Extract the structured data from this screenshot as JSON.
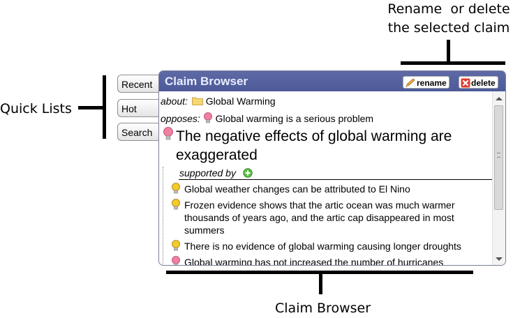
{
  "annotations": {
    "top_line1": "Rename  or delete",
    "top_line2": "the selected claim",
    "left": "Quick Lists",
    "bottom": "Claim Browser"
  },
  "quick_lists": [
    "Recent",
    "Hot",
    "Search"
  ],
  "browser": {
    "title": "Claim Browser",
    "rename_label": "rename",
    "delete_label": "delete",
    "about_label": "about:",
    "about_value": "Global Warming",
    "opposes_label": "opposes:",
    "opposes_value": "Global warming is a serious problem",
    "claim": "The negative effects of global warming are exaggerated",
    "supported_by": "supported by",
    "children": [
      {
        "lines": [
          "Global weather changes can be attributed to El Nino"
        ],
        "icon": "lightbulb-yellow"
      },
      {
        "lines": [
          "Frozen evidence shows that the artic ocean was much warmer",
          "thousands of years ago, and the artic cap disappeared in most",
          "summers"
        ],
        "icon": "lightbulb-yellow"
      },
      {
        "lines": [
          "There is no evidence of global warming causing longer droughts"
        ],
        "icon": "lightbulb-yellow"
      },
      {
        "lines": [
          "Global warming has not increased the number of hurricanes"
        ],
        "icon": "lightbulb-pink"
      }
    ]
  },
  "colors": {
    "titlebar": "#5260a0",
    "bulb_yellow": "#f5c400",
    "bulb_pink": "#ee6e92",
    "add_green": "#4caf3c"
  }
}
